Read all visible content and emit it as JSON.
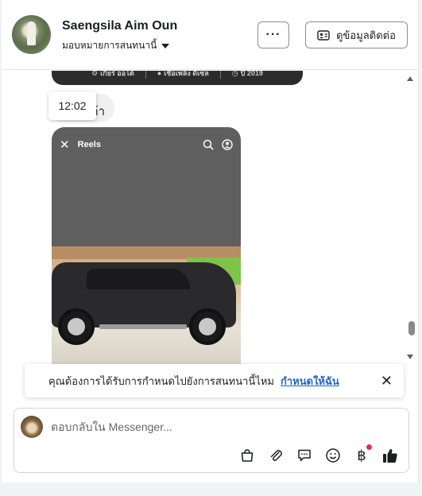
{
  "header": {
    "name": "Saengsila Aim Oun",
    "subtitle": "มอบหมายการสนทนานี้",
    "more_label": "···",
    "contact_label": "ดูข้อมูลติดต่อ"
  },
  "chat": {
    "card_top_items": [
      "เกียร์ ออโต้",
      "เชื้อเพลิง ดีเซล",
      "ปี 2019"
    ],
    "small_bubble_text": "ก้า",
    "tooltip_time": "12:02",
    "reel_label": "Reels"
  },
  "notice": {
    "text": "คุณต้องการได้รับการกำหนดไปยังการสนทนานี้ไหม",
    "link": "กำหนดให้ฉัน",
    "close": "✕"
  },
  "composer": {
    "placeholder": "ตอบกลับใน Messenger..."
  },
  "icons": {
    "more": "ellipsis-icon",
    "contact": "id-card-icon",
    "close_reel": "close-icon",
    "search": "search-icon",
    "profile": "user-circle-icon",
    "bag": "shopping-bag-icon",
    "attach": "paperclip-icon",
    "reply": "saved-reply-icon",
    "emoji": "emoji-icon",
    "payment": "baht-icon",
    "like": "thumbs-up-icon"
  },
  "colors": {
    "link": "#1f66c6",
    "like": "#1c1e21",
    "notification_dot": "#f02849",
    "reel_bg": "#5f5f5f"
  }
}
